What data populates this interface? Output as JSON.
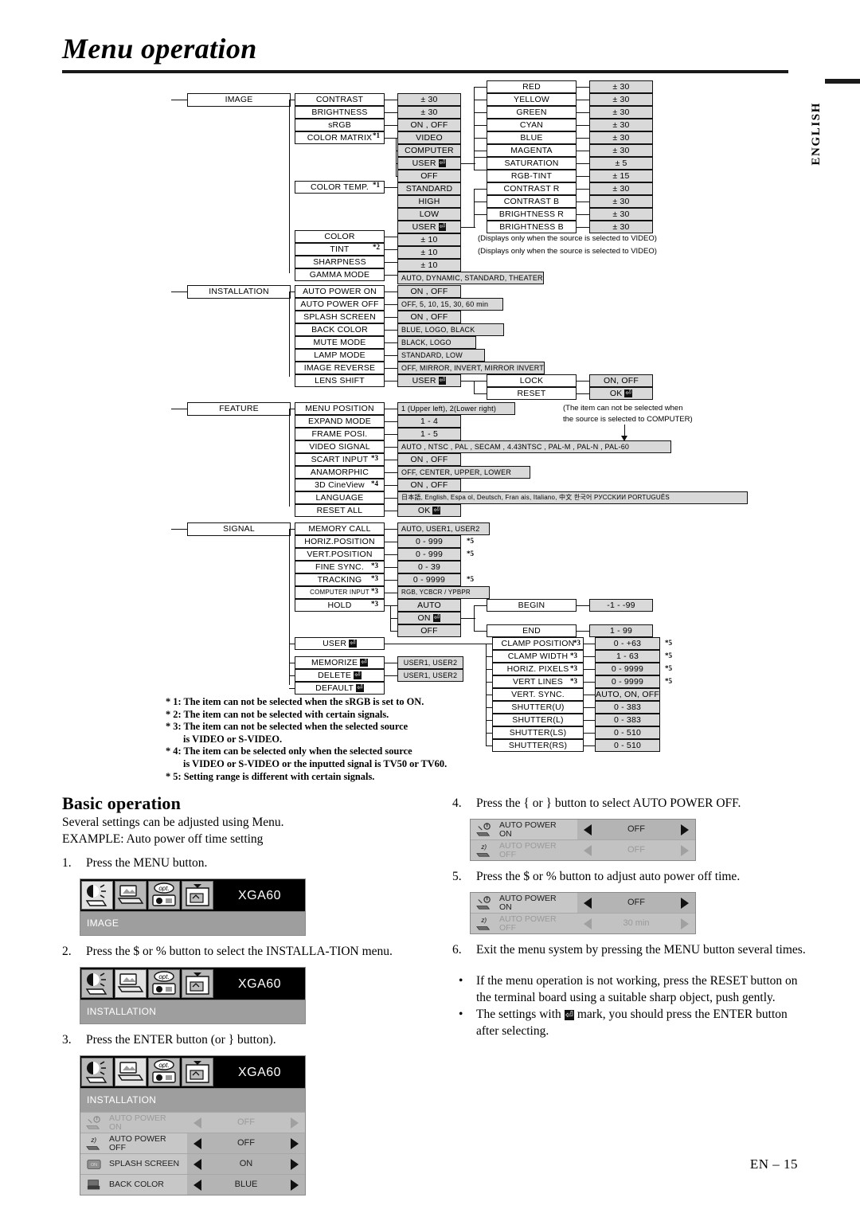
{
  "page": {
    "title": "Menu operation",
    "side_tab": "ENGLISH",
    "footer": "EN – 15"
  },
  "tree": {
    "image": {
      "root": "IMAGE",
      "items": [
        {
          "label": "CONTRAST",
          "value": "± 30"
        },
        {
          "label": "BRIGHTNESS",
          "value": "± 30"
        },
        {
          "label": "sRGB",
          "value": "ON , OFF"
        },
        {
          "label": "COLOR MATRIX",
          "sup": "*1",
          "value": "VIDEO"
        },
        {
          "label": "",
          "value": "COMPUTER"
        },
        {
          "label": "",
          "value": "USER"
        },
        {
          "label": "",
          "value": "OFF"
        },
        {
          "label": "COLOR TEMP.",
          "sup": "*1",
          "value": "STANDARD"
        },
        {
          "label": "",
          "value": "HIGH"
        },
        {
          "label": "",
          "value": "LOW"
        },
        {
          "label": "",
          "value": "USER"
        },
        {
          "label": "COLOR",
          "value": "± 10"
        },
        {
          "label": "TINT",
          "sup": "*2",
          "value": "± 10"
        },
        {
          "label": "SHARPNESS",
          "value": "± 10"
        },
        {
          "label": "GAMMA MODE",
          "value": "AUTO, DYNAMIC, STANDARD, THEATER"
        }
      ],
      "color_matrix_user": [
        {
          "label": "RED",
          "value": "± 30"
        },
        {
          "label": "YELLOW",
          "value": "± 30"
        },
        {
          "label": "GREEN",
          "value": "± 30"
        },
        {
          "label": "CYAN",
          "value": "± 30"
        },
        {
          "label": "BLUE",
          "value": "± 30"
        },
        {
          "label": "MAGENTA",
          "value": "± 30"
        },
        {
          "label": "SATURATION",
          "value": "± 5"
        },
        {
          "label": "RGB-TINT",
          "value": "± 15"
        }
      ],
      "color_temp_user": [
        {
          "label": "CONTRAST R",
          "value": "± 30"
        },
        {
          "label": "CONTRAST B",
          "value": "± 30"
        },
        {
          "label": "BRIGHTNESS R",
          "value": "± 30"
        },
        {
          "label": "BRIGHTNESS B",
          "value": "± 30"
        }
      ],
      "note_color": "(Displays only when the source is selected to VIDEO)",
      "note_tint": "(Displays only when the source is selected to VIDEO)"
    },
    "installation": {
      "root": "INSTALLATION",
      "items": [
        {
          "label": "AUTO POWER ON",
          "value": "ON , OFF"
        },
        {
          "label": "AUTO POWER OFF",
          "value": "OFF, 5,  10,  15,  30,  60 min"
        },
        {
          "label": "SPLASH SCREEN",
          "value": "ON , OFF"
        },
        {
          "label": "BACK COLOR",
          "value": "BLUE, LOGO, BLACK"
        },
        {
          "label": "MUTE MODE",
          "value": "BLACK, LOGO"
        },
        {
          "label": "LAMP MODE",
          "value": "STANDARD, LOW"
        },
        {
          "label": "IMAGE REVERSE",
          "value": "OFF, MIRROR, INVERT, MIRROR INVERT"
        },
        {
          "label": "LENS SHIFT",
          "value": "USER"
        }
      ],
      "lens_shift_sub": [
        {
          "label": "LOCK",
          "value": "ON, OFF"
        },
        {
          "label": "RESET",
          "value": "OK"
        }
      ]
    },
    "feature": {
      "root": "FEATURE",
      "items": [
        {
          "label": "MENU POSITION",
          "value": "1 (Upper left), 2(Lower right)"
        },
        {
          "label": "EXPAND MODE",
          "value": "1 - 4"
        },
        {
          "label": "FRAME POSI.",
          "value": "1 - 5"
        },
        {
          "label": "VIDEO SIGNAL",
          "value": "AUTO , NTSC , PAL , SECAM , 4.43NTSC , PAL-M , PAL-N , PAL-60"
        },
        {
          "label": "SCART INPUT",
          "sup": "*3",
          "value": "ON , OFF"
        },
        {
          "label": "ANAMORPHIC",
          "value": "OFF, CENTER, UPPER, LOWER"
        },
        {
          "label": "3D CineView",
          "sup": "*4",
          "value": "ON , OFF"
        },
        {
          "label": "LANGUAGE",
          "value": "日本語, English, Espa ol, Deutsch, Fran ais, Italiano, 中文 한국어 PУCCKИИ PORTUGUÊS"
        },
        {
          "label": "RESET ALL",
          "value": "OK"
        }
      ],
      "callout_line1": "(The item can not be selected when",
      "callout_line2": "the source is selected to COMPUTER)"
    },
    "signal": {
      "root": "SIGNAL",
      "items": [
        {
          "label": "MEMORY CALL",
          "value": "AUTO, USER1, USER2",
          "sup5": ""
        },
        {
          "label": "HORIZ.POSITION",
          "value": "0 - 999",
          "sup5": "*5"
        },
        {
          "label": "VERT.POSITION",
          "value": "0 - 999",
          "sup5": "*5"
        },
        {
          "label": "FINE SYNC.",
          "sup": "*3",
          "value": "0 - 39",
          "sup5": ""
        },
        {
          "label": "TRACKING",
          "sup": "*3",
          "value": "0 - 9999",
          "sup5": "*5"
        },
        {
          "label": "COMPUTER INPUT",
          "sup": "*3",
          "value": "RGB, YCBCR / YPBPR",
          "sup5": ""
        },
        {
          "label": "HOLD",
          "sup": "*3",
          "value": "AUTO",
          "sup5": ""
        }
      ],
      "hold_values": [
        "AUTO",
        "ON",
        "OFF"
      ],
      "hold_sub": [
        {
          "label": "BEGIN",
          "value": "-1 - -99"
        },
        {
          "label": "END",
          "value": "1 - 99"
        }
      ],
      "user_group": [
        {
          "label": "USER",
          "value": ""
        },
        {
          "label": "MEMORIZE",
          "value": "USER1, USER2"
        },
        {
          "label": "DELETE",
          "value": "USER1, USER2"
        },
        {
          "label": "DEFAULT",
          "value": ""
        }
      ],
      "user_sub": [
        {
          "label": "CLAMP POSITION",
          "sup": "*3",
          "value": "0 - +63",
          "sup5": "*5"
        },
        {
          "label": "CLAMP WIDTH",
          "sup": "*3",
          "value": "1 - 63",
          "sup5": "*5"
        },
        {
          "label": "HORIZ. PIXELS",
          "sup": "*3",
          "value": "0 - 9999",
          "sup5": "*5"
        },
        {
          "label": "VERT LINES",
          "sup": "*3",
          "value": "0 - 9999",
          "sup5": "*5"
        },
        {
          "label": "VERT. SYNC.",
          "sup": "",
          "value": "AUTO, ON, OFF",
          "sup5": ""
        },
        {
          "label": "SHUTTER(U)",
          "sup": "",
          "value": "0 - 383",
          "sup5": ""
        },
        {
          "label": "SHUTTER(L)",
          "sup": "",
          "value": "0 - 383",
          "sup5": ""
        },
        {
          "label": "SHUTTER(LS)",
          "sup": "",
          "value": "0 - 510",
          "sup5": ""
        },
        {
          "label": "SHUTTER(RS)",
          "sup": "",
          "value": "0 - 510",
          "sup5": ""
        }
      ]
    }
  },
  "footnotes": [
    "* 1: The item can not be selected when the sRGB is set to ON.",
    "* 2: The item can not be selected with certain signals.",
    "* 3: The item can not be selected when the selected source",
    "is VIDEO or S-VIDEO.",
    "* 4: The item can be selected only when the selected source",
    "is VIDEO or S-VIDEO or the inputted signal is TV50 or TV60.",
    "* 5: Setting range is different with certain signals."
  ],
  "basic": {
    "heading": "Basic operation",
    "intro1": "Several settings can be adjusted using Menu.",
    "intro2": "EXAMPLE: Auto power off time setting",
    "step1_num": "1.",
    "step1": "Press the MENU button.",
    "step2_num": "2.",
    "step2": "Press the $   or %  button to select the INSTALLA-TION menu.",
    "step3_num": "3.",
    "step3": "Press the ENTER button (or }    button).",
    "step4_num": "4.",
    "step4": "Press the {   or }   button to select AUTO POWER OFF.",
    "step5_num": "5.",
    "step5": "Press the $   or %  button to adjust auto power off time.",
    "step6_num": "6.",
    "step6": "Exit the menu system by pressing the MENU button several times.",
    "bullet_mark": "•",
    "bullet1": "If the menu operation is not working, press the RESET button on the terminal board using a suitable sharp object, push gently.",
    "bullet2a": "The settings with",
    "bullet2b": "mark, you should press the ENTER button after selecting."
  },
  "osd": {
    "signal_name": "XGA60",
    "screen1_menu": "IMAGE",
    "screen2_menu": "INSTALLATION",
    "screen3_menu": "INSTALLATION",
    "rows3": [
      {
        "l1": "AUTO POWER",
        "l2": "ON",
        "value": "OFF",
        "dim": true
      },
      {
        "l1": "AUTO POWER",
        "l2": "OFF",
        "value": "OFF",
        "dim": false
      },
      {
        "l1": "SPLASH SCREEN",
        "l2": "",
        "value": "ON",
        "dim": false
      },
      {
        "l1": "BACK COLOR",
        "l2": "",
        "value": "BLUE",
        "dim": false
      }
    ],
    "rows4": [
      {
        "l1": "AUTO POWER",
        "l2": "ON",
        "value": "OFF",
        "dim": false
      },
      {
        "l1": "AUTO POWER",
        "l2": "OFF",
        "value": "OFF",
        "dim": true
      }
    ],
    "rows5": [
      {
        "l1": "AUTO POWER",
        "l2": "ON",
        "value": "OFF",
        "dim": false
      },
      {
        "l1": "AUTO POWER",
        "l2": "OFF",
        "value": "30 min",
        "dim": true
      }
    ]
  }
}
